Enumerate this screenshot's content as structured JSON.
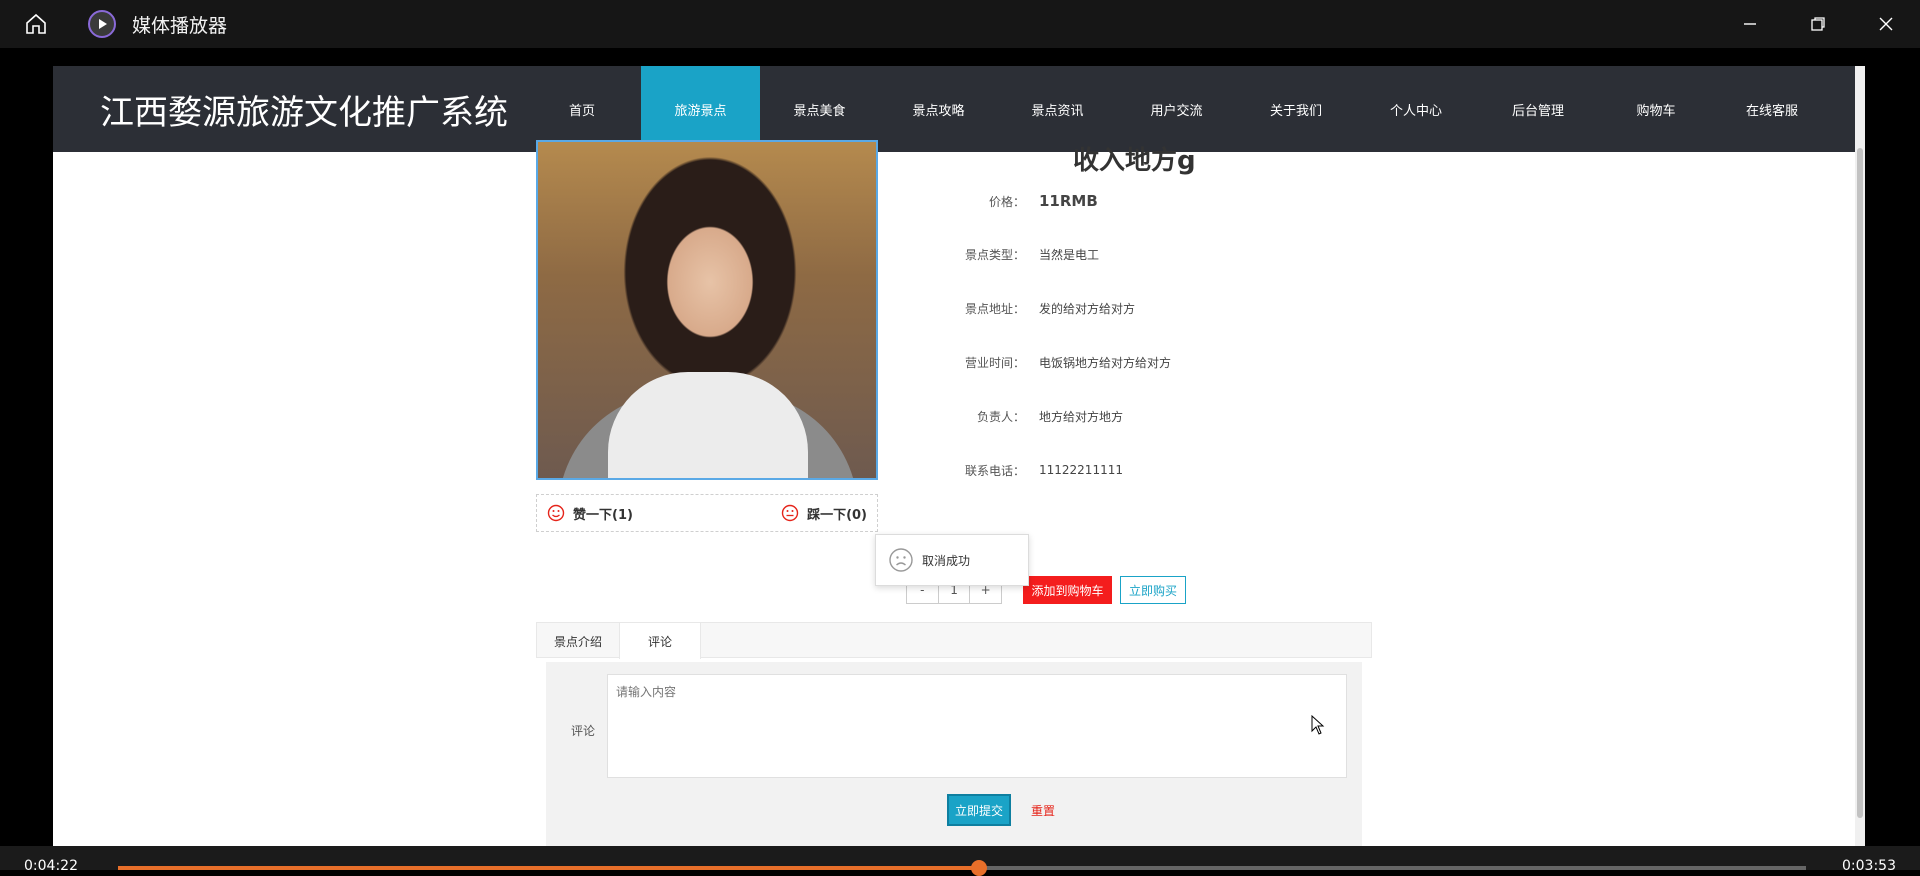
{
  "player": {
    "title": "媒体播放器",
    "time_current": "0:04:22",
    "time_total": "0:03:53",
    "progress": 0.51
  },
  "site": {
    "brand": "江西婺源旅游文化推广系统",
    "nav": [
      {
        "label": "首页",
        "active": false
      },
      {
        "label": "旅游景点",
        "active": true
      },
      {
        "label": "景点美食",
        "active": false
      },
      {
        "label": "景点攻略",
        "active": false
      },
      {
        "label": "景点资讯",
        "active": false
      },
      {
        "label": "用户交流",
        "active": false
      },
      {
        "label": "关于我们",
        "active": false
      },
      {
        "label": "个人中心",
        "active": false
      },
      {
        "label": "后台管理",
        "active": false
      },
      {
        "label": "购物车",
        "active": false
      },
      {
        "label": "在线客服",
        "active": false
      }
    ]
  },
  "detail": {
    "title": "收入地方g",
    "fields": [
      {
        "label": "价格：",
        "value": "11RMB"
      },
      {
        "label": "景点类型：",
        "value": "当然是电工"
      },
      {
        "label": "景点地址：",
        "value": "发的给对方给对方"
      },
      {
        "label": "营业时间：",
        "value": "电饭锅地方给对方给对方"
      },
      {
        "label": "负责人：",
        "value": "地方给对方地方"
      },
      {
        "label": "联系电话：",
        "value": "11122211111"
      }
    ],
    "like_label": "赞一下(1)",
    "dislike_label": "踩一下(0)",
    "toast": "取消成功",
    "qty_minus": "-",
    "qty_value": "1",
    "qty_plus": "+",
    "add_cart": "添加到购物车",
    "buy_now": "立即购买"
  },
  "tabs": [
    {
      "label": "景点介绍",
      "active": false
    },
    {
      "label": "评论",
      "active": true
    }
  ],
  "comment": {
    "label": "评论",
    "placeholder": "请输入内容",
    "submit": "立即提交",
    "reset": "重置"
  },
  "colors": {
    "accent": "#1aa3c7",
    "nav_bg": "#2c2f36",
    "danger": "#f41d1d",
    "progress": "#e86f2a"
  }
}
